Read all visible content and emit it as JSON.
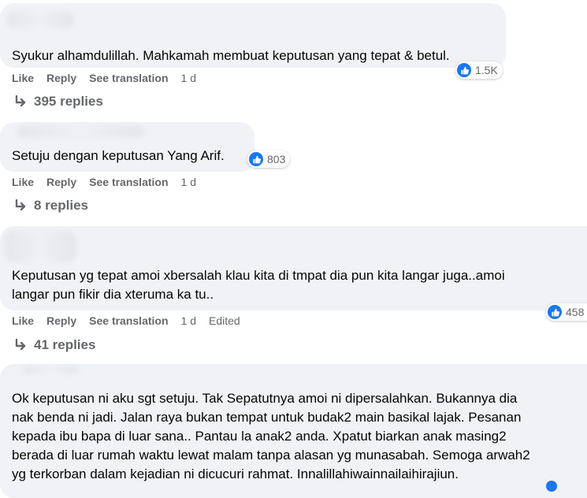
{
  "comments": [
    {
      "text_lines": [
        "Syukur alhamdulillah. Mahkamah membuat keputusan yang tepat & betul."
      ],
      "actions": {
        "like": "Like",
        "reply": "Reply",
        "translate": "See translation",
        "time": "1 d"
      },
      "reaction_count": "1.5K",
      "replies": "395 replies"
    },
    {
      "text_lines": [
        "Setuju dengan keputusan Yang Arif."
      ],
      "actions": {
        "like": "Like",
        "reply": "Reply",
        "translate": "See translation",
        "time": "1 d"
      },
      "reaction_count": "803",
      "replies": "8 replies"
    },
    {
      "text_lines": [
        "Keputusan yg tepat amoi xbersalah klau kita di tmpat dia pun kita langar juga..amoi",
        "langar pun fikir dia xteruma ka tu.."
      ],
      "actions": {
        "like": "Like",
        "reply": "Reply",
        "translate": "See translation",
        "time": "1 d",
        "edited": "Edited"
      },
      "reaction_count": "458",
      "replies": "41 replies"
    },
    {
      "text_lines": [
        "Ok keputusan ni aku sgt setuju. Tak Sepatutnya amoi ni dipersalahkan. Bukannya dia",
        "nak benda ni jadi. Jalan raya bukan tempat untuk budak2 main basikal lajak. Pesanan",
        "kepada ibu bapa di luar sana.. Pantau la anak2 anda. Xpatut biarkan anak masing2",
        "berada di luar rumah waktu lewat malam tanpa alasan yg munasabah. Semoga arwah2",
        "yg terkorban dalam kejadian ni dicucuri rahmat. Innalillahiwainnailaihirajiun."
      ]
    }
  ],
  "icons": {
    "like": "thumbs-up-icon",
    "reply_arrow": "reply-arrow-icon"
  },
  "colors": {
    "like_blue": "#1877f2",
    "bubble": "#f0f2f5",
    "secondary_text": "#65676b"
  }
}
